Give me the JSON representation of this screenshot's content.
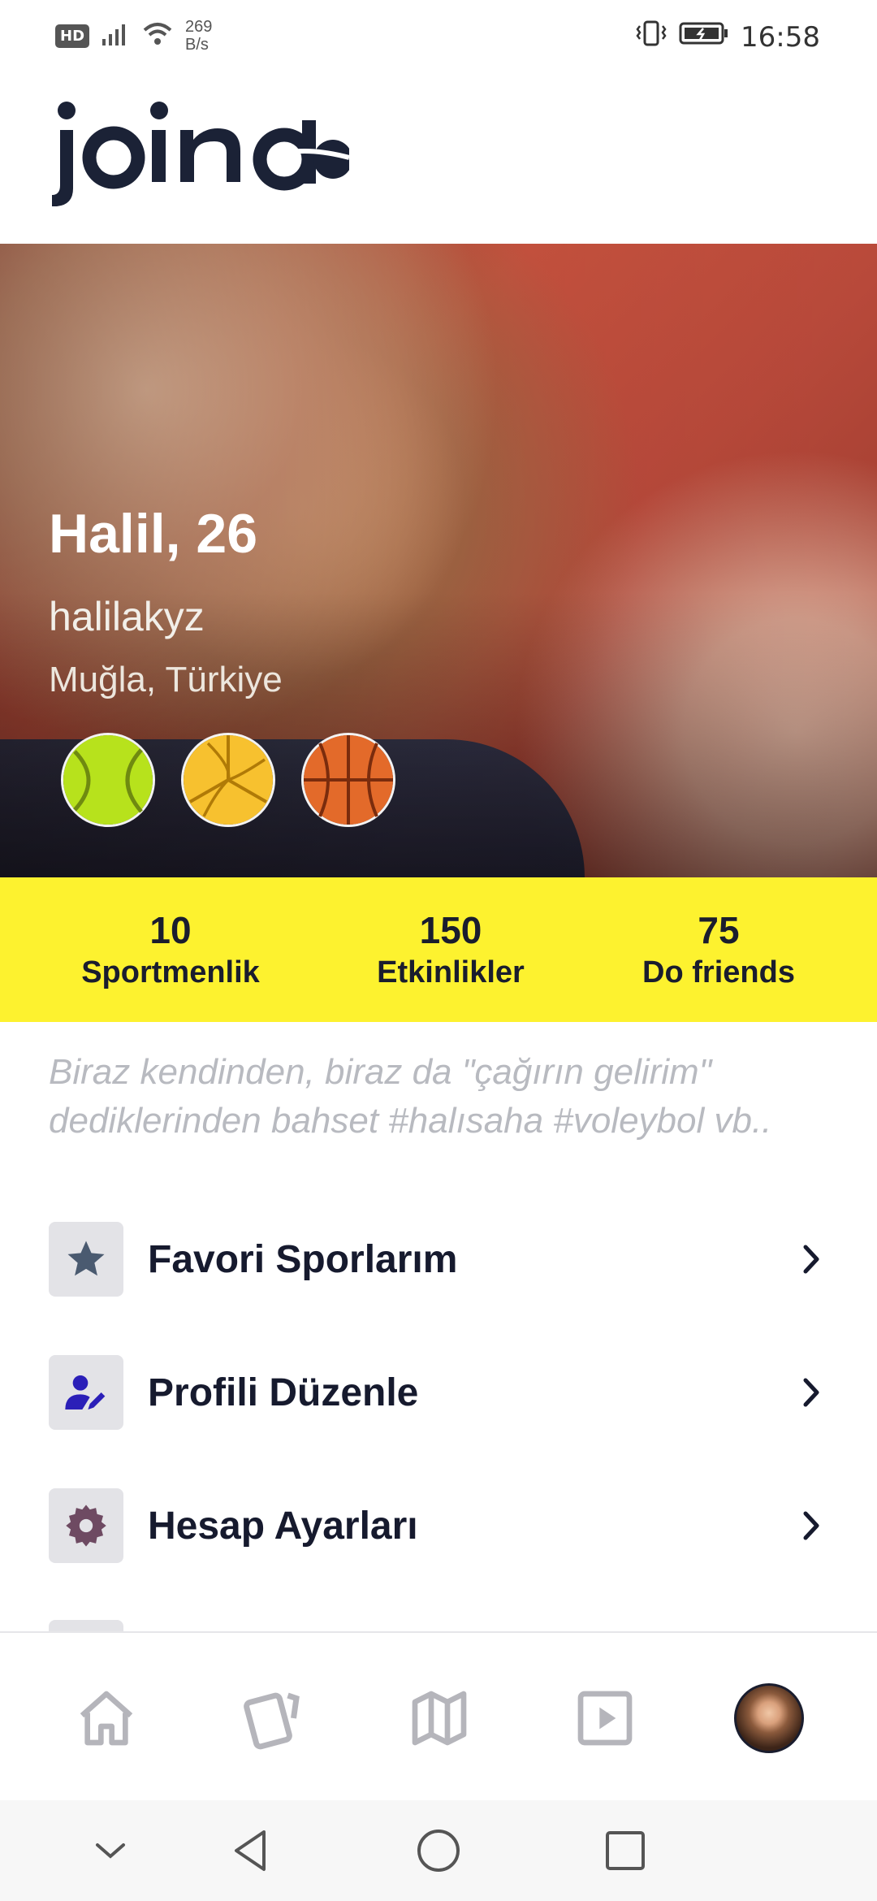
{
  "status_bar": {
    "hd_badge": "HD",
    "network_speed_value": "269",
    "network_speed_unit": "B/s",
    "time": "16:58",
    "icons": [
      "signal-icon",
      "wifi-icon",
      "vibrate-icon",
      "battery-icon"
    ]
  },
  "header": {
    "logo_text": "join do"
  },
  "profile": {
    "name_age": "Halil, 26",
    "username": "halilakyz",
    "location": "Muğla, Türkiye",
    "sports": [
      "tennis",
      "volleyball",
      "basketball"
    ]
  },
  "stats": [
    {
      "value": "10",
      "label": "Sportmenlik"
    },
    {
      "value": "150",
      "label": "Etkinlikler"
    },
    {
      "value": "75",
      "label": "Do friends"
    }
  ],
  "bio_placeholder": "Biraz kendinden, biraz da \"çağırın gelirim\" dediklerinden bahset #halısaha #voleybol vb..",
  "menu": [
    {
      "label": "Favori Sporlarım",
      "icon": "star-icon",
      "icon_color": "#4a5a70"
    },
    {
      "label": "Profili Düzenle",
      "icon": "edit-user-icon",
      "icon_color": "#2b1fb8"
    },
    {
      "label": "Hesap Ayarları",
      "icon": "gear-icon",
      "icon_color": "#6e4a62"
    }
  ],
  "bottom_nav": [
    "home-icon",
    "cards-icon",
    "map-icon",
    "play-icon",
    "profile-avatar"
  ],
  "colors": {
    "accent_yellow": "#fdf22f",
    "text_dark": "#1a1d2e",
    "placeholder_grey": "#b8bac0",
    "nav_icon_grey": "#b5b5bb"
  }
}
